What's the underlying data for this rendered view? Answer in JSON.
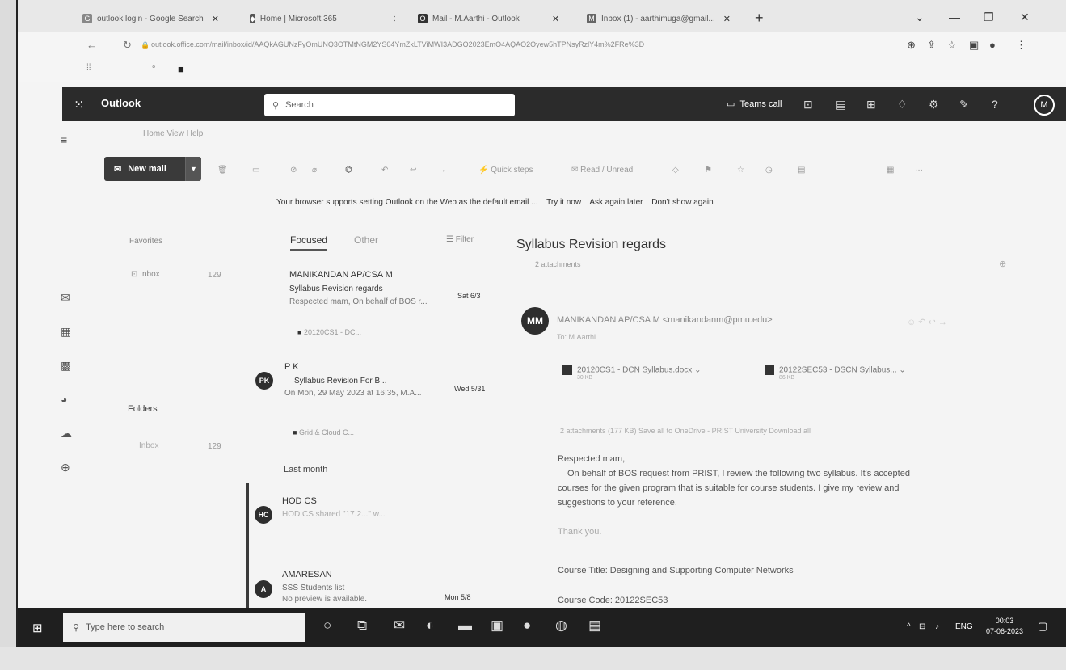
{
  "browser": {
    "tabs": [
      {
        "label": "outlook login - Google Search",
        "icon": "google-icon"
      },
      {
        "label": "Home | Microsoft 365",
        "icon": "microsoft-365-icon"
      },
      {
        "label": "Mail - M.Aarthi - Outlook",
        "icon": "outlook-icon"
      },
      {
        "label": "Inbox (1) - aarthimuga@gmail...",
        "icon": "gmail-icon"
      }
    ],
    "url": "outlook.office.com/mail/inbox/id/AAQkAGUNzFyOmUNQ3OTMtNGM2YS04YmZkLTViMWI3ADGQ2023EmO4AQAO2Oyew5hTPNsyRzlY4m%2FRe%3D"
  },
  "outlook": {
    "brand": "Outlook",
    "search_placeholder": "Search",
    "teams_call": "Teams call",
    "avatar_initial": "M",
    "ribbon_tabs": "Home    View    Help",
    "new_mail": "New mail",
    "toolbar": {
      "quick_steps": "Quick steps",
      "read_unread": "Read / Unread"
    },
    "infobar": {
      "message": "Your browser supports setting Outlook on the Web as the default email ...",
      "try": "Try it now",
      "ask": "Ask again later",
      "dont": "Don't show again"
    }
  },
  "folders": {
    "favorites": "Favorites",
    "inbox": "Inbox",
    "inbox_count": "129",
    "heading": "Folders",
    "inbox2": "Inbox",
    "inbox2_count": "129"
  },
  "message_list": {
    "tab_focused": "Focused",
    "tab_other": "Other",
    "filter": "Filter",
    "group_last_month": "Last month",
    "messages": [
      {
        "sender": "MANIKANDAN AP/CSA M",
        "subject": "Syllabus Revision regards",
        "date": "Sat 6/3",
        "preview": "Respected mam, On behalf of BOS r...",
        "attachment": "20120CS1 - DC..."
      },
      {
        "initials": "PK",
        "sender": "P K",
        "subject": "Syllabus Revision For B...",
        "date": "Wed 5/31",
        "preview": "On Mon, 29 May 2023 at 16:35, M.A...",
        "attachment": "Grid & Cloud C..."
      },
      {
        "initials": "HC",
        "sender": "HOD CS",
        "preview": "HOD CS shared \"17.2...\" w..."
      },
      {
        "initials": "A",
        "sender": "AMARESAN",
        "subject": "SSS Students list",
        "date": "Mon 5/8",
        "preview": "No preview is available."
      }
    ]
  },
  "reading_pane": {
    "subject": "Syllabus Revision regards",
    "attachments_label": "2 attachments",
    "sender_initials": "MM",
    "from": "MANIKANDAN AP/CSA M <manikandanm@pmu.edu>",
    "to": "To: M.Aarthi",
    "files": [
      {
        "name": "20120CS1 - DCN Syllabus.docx",
        "size": "30 KB"
      },
      {
        "name": "20122SEC53 - DSCN Syllabus...",
        "size": "86 KB"
      }
    ],
    "attach_line": "2 attachments (177 KB)   Save all to OneDrive - PRIST University   Download all",
    "body": [
      "Respected mam,",
      "On behalf of BOS request from PRIST, I review the following two syllabus. It's accepted",
      "courses for the given program  that is suitable for course students. I give my review and",
      "suggestions to your reference.",
      "Thank you.",
      "Course Title: Designing and Supporting Computer Networks",
      "Course Code: 20122SEC53"
    ]
  },
  "taskbar": {
    "search_placeholder": "Type here to search",
    "lang": "ENG",
    "time": "00:03",
    "date": "07-06-2023"
  }
}
